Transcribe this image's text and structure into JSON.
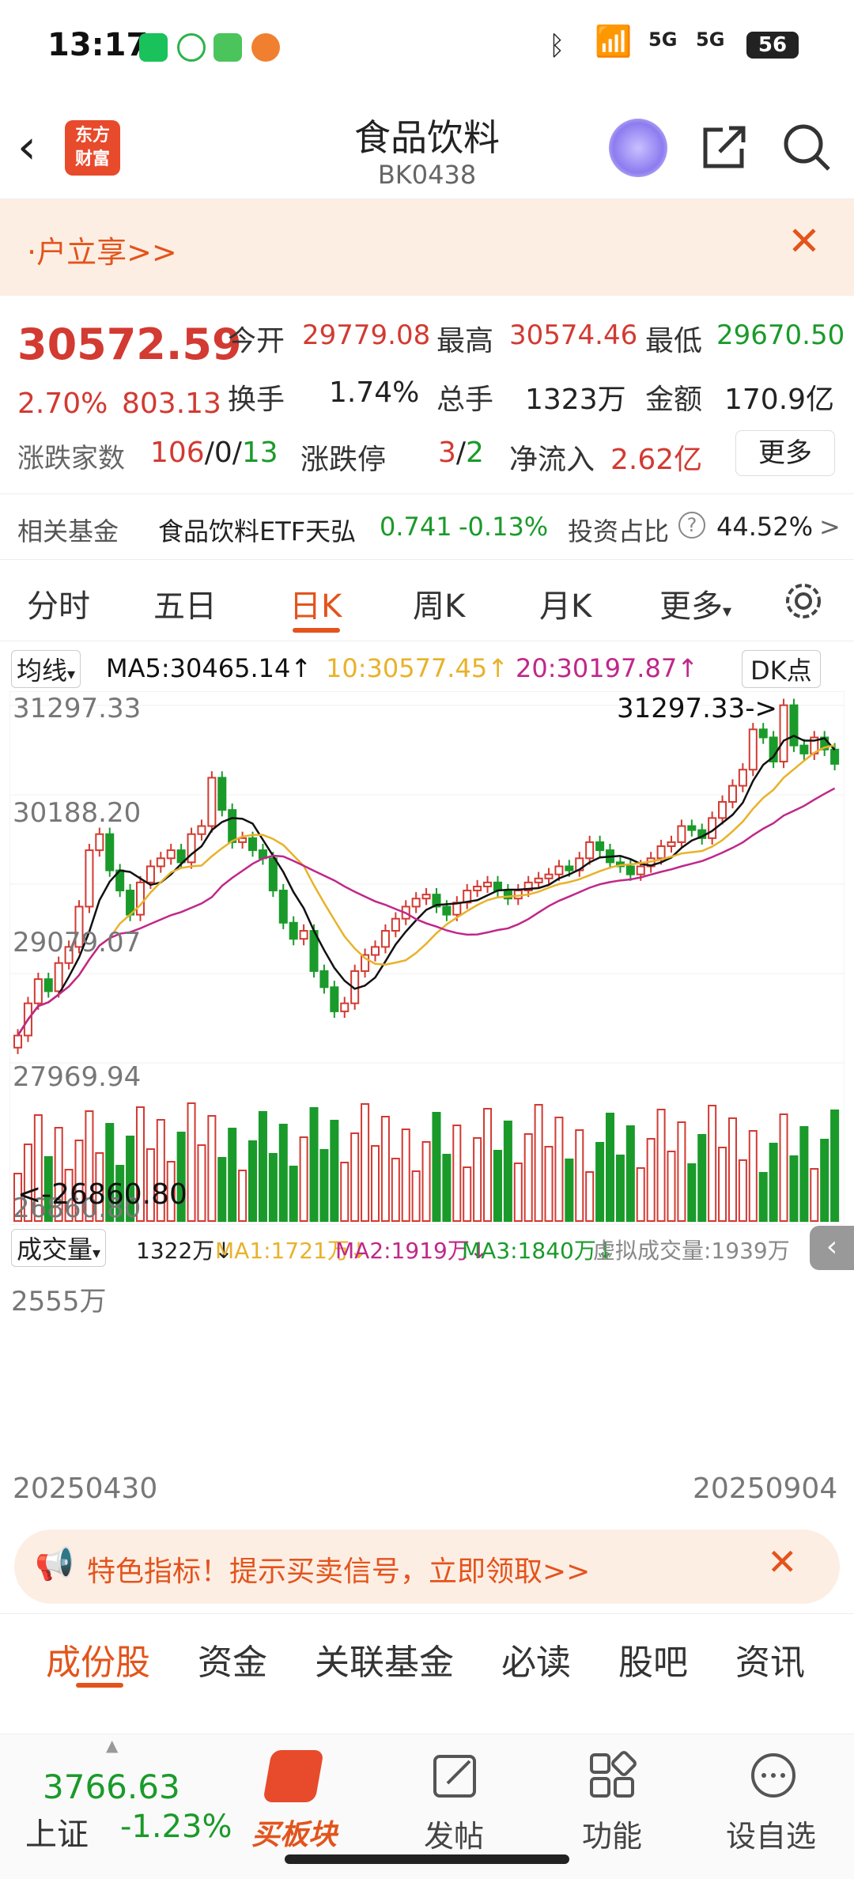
{
  "status": {
    "time": "13:17",
    "battery": "56",
    "network1": "5G",
    "network2": "5G"
  },
  "header": {
    "title": "食品饮料",
    "code": "BK0438",
    "logo_line1": "东方",
    "logo_line2": "财富"
  },
  "promo": {
    "text": "·户立享>>"
  },
  "quote": {
    "price": "30572.59",
    "change_pct": "2.70%",
    "change": "803.13",
    "open_label": "今开",
    "open": "29779.08",
    "high_label": "最高",
    "high": "30574.46",
    "low_label": "最低",
    "low": "29670.50",
    "turnover_label": "换手",
    "turnover": "1.74%",
    "volume_label": "总手",
    "volume": "1323万",
    "amount_label": "金额",
    "amount": "170.9亿",
    "breadth_label": "涨跌家数",
    "up": "106",
    "flat": "0",
    "down": "13",
    "limit_label": "涨跌停",
    "limit_up": "3",
    "limit_down": "2",
    "netflow_label": "净流入",
    "netflow": "2.62亿",
    "more_label": "更多",
    "sep": "/"
  },
  "fund": {
    "label": "相关基金",
    "name": "食品饮料ETF天弘",
    "price": "0.741",
    "change": "-0.13%",
    "ratio_label": "投资占比",
    "ratio": "44.52%",
    "arrow": ">"
  },
  "tabs": [
    "分时",
    "五日",
    "日K",
    "周K",
    "月K",
    "更多"
  ],
  "ma": {
    "label": "均线",
    "ma5": "MA5:30465.14↑",
    "ma10": "10:30577.45↑",
    "ma20": "20:30197.87↑",
    "dk": "DK点"
  },
  "axis": {
    "y1": "31297.33",
    "y2": "30188.20",
    "y3": "29079.07",
    "y4": "27969.94",
    "y5": "26860.80",
    "max_note": "31297.33->",
    "min_note": "<-26860.80",
    "vol_max": "2555万",
    "date_start": "20250430",
    "date_end": "20250904"
  },
  "vol": {
    "label": "成交量",
    "cur": "1322万↓",
    "ma1": "MA1:1721万↓",
    "ma2": "MA2:1919万↓",
    "ma3": "MA3:1840万↓",
    "virtual": "虚拟成交量:1939万"
  },
  "banner": {
    "text": "特色指标！提示买卖信号，立即领取>>"
  },
  "sections": [
    "成份股",
    "资金",
    "关联基金",
    "必读",
    "股吧",
    "资讯"
  ],
  "bottom": {
    "index_value": "3766.63",
    "index_name": "上证",
    "index_change": "-1.23%",
    "buy": "买板块",
    "post": "发帖",
    "func": "功能",
    "watch": "设自选"
  },
  "colors": {
    "up": "#d23a32",
    "down": "#1a9a2a",
    "accent": "#e3541c",
    "ma5": "#111111",
    "ma10": "#e8b22a",
    "ma20": "#c0278a"
  },
  "chart_data": {
    "type": "candlestick",
    "ylim": [
      26860.8,
      31297.33
    ],
    "y_ticks": [
      31297.33,
      30188.2,
      29079.07,
      27969.94,
      26860.8
    ],
    "x_range": [
      "20250430",
      "20250904"
    ],
    "close": [
      27200,
      27600,
      27900,
      27750,
      28100,
      28300,
      28800,
      29500,
      29700,
      29250,
      29000,
      28700,
      29100,
      29300,
      29400,
      29500,
      29350,
      29700,
      29800,
      30400,
      30000,
      29600,
      29650,
      29500,
      29400,
      29000,
      28600,
      28400,
      28500,
      28000,
      27800,
      27500,
      27600,
      28000,
      28200,
      28300,
      28500,
      28650,
      28800,
      28900,
      28950,
      28800,
      28700,
      28850,
      29000,
      29050,
      29100,
      29000,
      28900,
      29000,
      29100,
      29150,
      29200,
      29300,
      29250,
      29400,
      29600,
      29500,
      29350,
      29300,
      29200,
      29300,
      29400,
      29550,
      29600,
      29800,
      29750,
      29650,
      29900,
      30100,
      30300,
      30500,
      31000,
      30900,
      30600,
      31300,
      30800,
      30700,
      30900,
      30750,
      30572
    ],
    "volume_max": 2555
  }
}
